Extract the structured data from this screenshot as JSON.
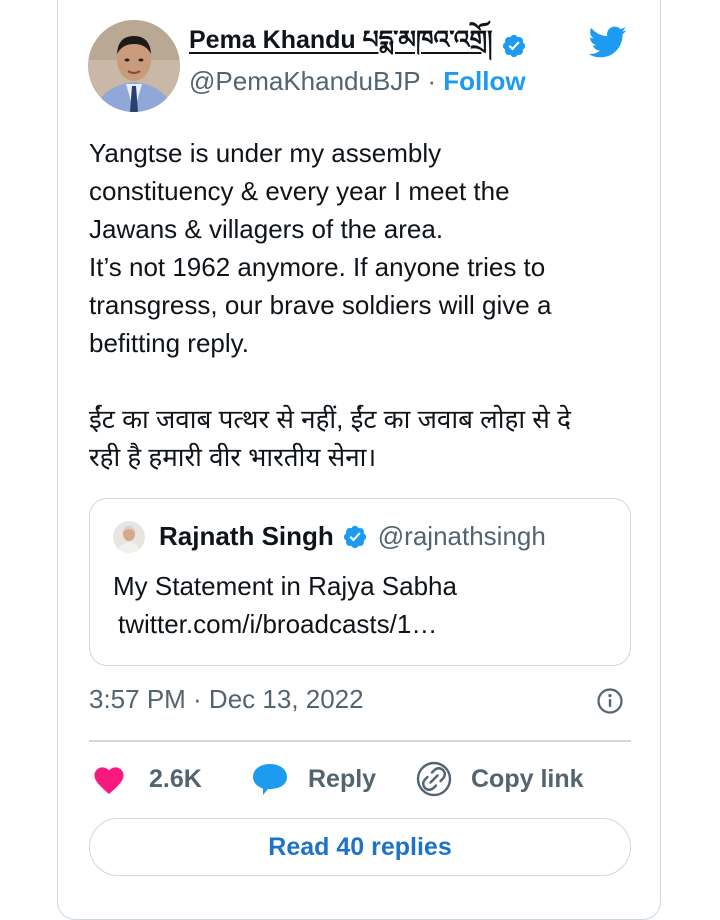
{
  "author": {
    "display_name": "Pema Khandu པདྨ་མཁའ་འགྲོ།",
    "handle": "@PemaKhanduBJP",
    "separator": " · ",
    "follow_label": "Follow",
    "verified": true
  },
  "tweet": {
    "paragraph1": [
      "Yangtse is under my assembly",
      "constituency & every year I meet the",
      "Jawans & villagers of the area.",
      "It’s not 1962 anymore. If anyone tries to",
      "transgress, our brave soldiers will give a",
      "befitting reply."
    ],
    "paragraph2": [
      "ईंट का जवाब पत्थर से नहीं, ईंट का जवाब लोहा से दे",
      "रही है हमारी वीर भारतीय सेना।"
    ],
    "timestamp": "3:57 PM · Dec 13, 2022"
  },
  "quoted_tweet": {
    "name": "Rajnath Singh",
    "handle": "@rajnathsingh",
    "verified": true,
    "text": "My Statement in Rajya Sabha",
    "link": "twitter.com/i/broadcasts/1…"
  },
  "actions": {
    "likes": "2.6K",
    "reply_label": "Reply",
    "copy_link_label": "Copy link"
  },
  "read_replies_label": "Read 40 replies",
  "icons": [
    "verified-badge-icon",
    "twitter-bird-icon",
    "info-icon",
    "heart-icon",
    "reply-bubble-icon",
    "link-icon"
  ],
  "colors": {
    "accent": "#1d9bf0",
    "like": "#f91880",
    "muted_text": "#536471",
    "border": "#cfd9de"
  }
}
